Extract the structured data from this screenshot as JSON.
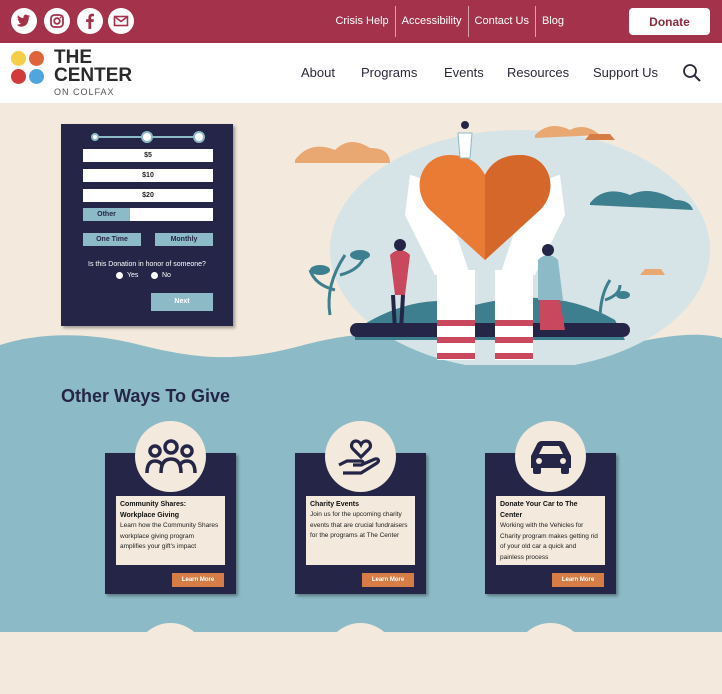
{
  "topbar": {
    "social": [
      "twitter-icon",
      "instagram-icon",
      "facebook-icon",
      "mail-icon"
    ],
    "links": [
      "Crisis Help",
      "Accessibility",
      "Contact Us",
      "Blog"
    ],
    "donate": "Donate"
  },
  "logo": {
    "line1": "THE",
    "line2": "CENTER",
    "line3": "ON COLFAX"
  },
  "nav": {
    "items": [
      "About",
      "Programs",
      "Events",
      "Resources",
      "Support Us"
    ]
  },
  "donation_form": {
    "amounts": [
      "$5",
      "$10",
      "$20"
    ],
    "other": "Other",
    "frequency": [
      "One Time",
      "Monthly"
    ],
    "honor_question": "Is this Donation in honor of someone?",
    "yes": "Yes",
    "no": "No",
    "next": "Next"
  },
  "other_ways": {
    "title": "Other Ways To Give",
    "cards": [
      {
        "icon": "people-group-icon",
        "title": "Community Shares: Workplace Giving",
        "text": "Learn how the Community Shares workplace giving program amplifies your gift's impact",
        "button": "Learn More"
      },
      {
        "icon": "heart-hand-icon",
        "title": "Charity Events",
        "text": "Join us for the upcoming charity events that are crucial fundraisers for the programs at The Center",
        "button": "Learn More"
      },
      {
        "icon": "car-icon",
        "title": "Donate Your Car to The Center",
        "text": "Working with the Vehicles for Charity program makes getting rid of your old car a quick and painless process",
        "button": "Learn More"
      }
    ]
  },
  "colors": {
    "burgundy": "#a4324a",
    "navy": "#252647",
    "teal": "#8cbac6",
    "cream": "#f3e9dc",
    "orange": "#d57d45"
  }
}
